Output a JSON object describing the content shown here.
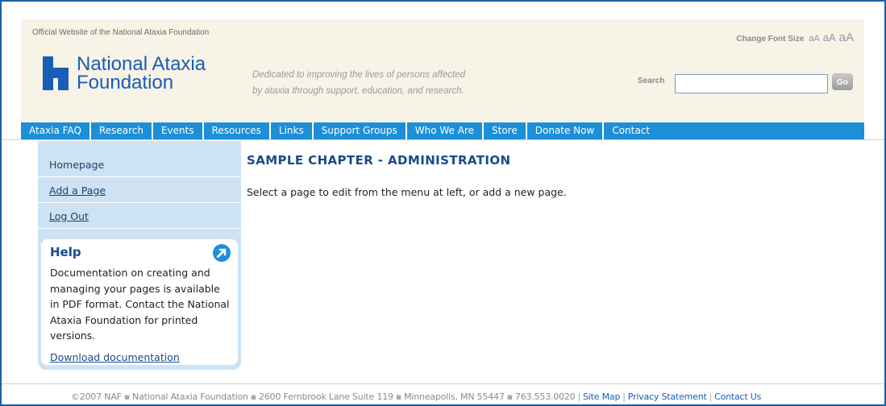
{
  "header": {
    "official_text": "Official Website of the National Ataxia Foundation",
    "font_size_label": "Change Font Size",
    "font_size_options": [
      "aA",
      "aA",
      "aA"
    ],
    "logo_line1": "National Ataxia",
    "logo_line2": "Foundation",
    "tagline_line1": "Dedicated to improving the lives of persons affected",
    "tagline_line2": "by ataxia through support, education, and research.",
    "search_label": "Search",
    "search_value": "",
    "go_label": "Go"
  },
  "nav": [
    "Ataxia FAQ",
    "Research",
    "Events",
    "Resources",
    "Links",
    "Support Groups",
    "Who We Are",
    "Store",
    "Donate Now",
    "Contact"
  ],
  "sidebar": {
    "items": [
      "Homepage",
      "Add a Page",
      "Log Out"
    ],
    "help_title": "Help",
    "help_text": "Documentation on creating and managing your pages is available in PDF format. Contact the National Ataxia Foundation for printed versions.",
    "help_link": "Download documentation"
  },
  "main": {
    "title": "SAMPLE CHAPTER - ADMINISTRATION",
    "text": "Select a page to edit from the menu at left, or add a new page."
  },
  "footer": {
    "copyright": "©2007 NAF",
    "org": "National Ataxia Foundation",
    "address": "2600 Fernbrook Lane Suite 119",
    "city": "Minneapolis, MN 55447",
    "phone": "763.553.0020",
    "links": [
      "Site Map",
      "Privacy Statement",
      "Contact Us"
    ]
  },
  "colors": {
    "brand_blue": "#1a5db4",
    "nav_blue": "#1c8fd8",
    "sidebar_bg": "#cde3f3",
    "header_bg": "#f7f3e6"
  },
  "icons": {
    "logo": "naf-logo-mark",
    "help": "arrow-up-right-circle-icon"
  }
}
